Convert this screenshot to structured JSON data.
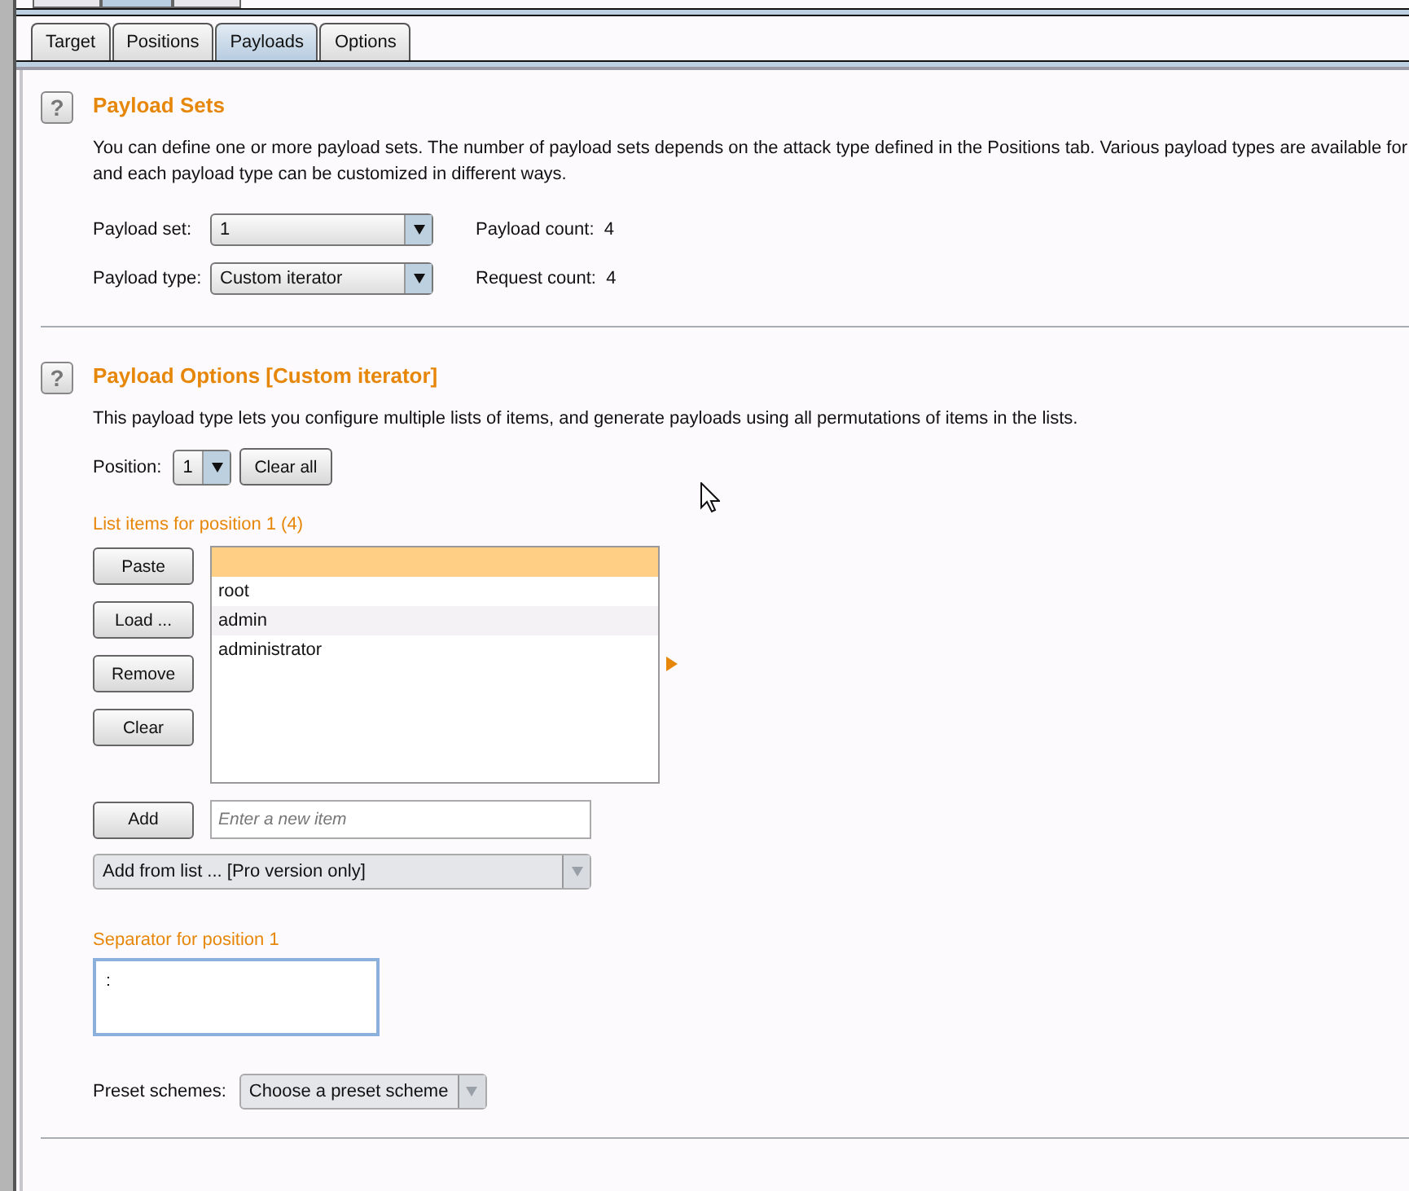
{
  "outer_tabs": [
    {
      "selected": false
    },
    {
      "selected": true
    },
    {
      "selected": false
    }
  ],
  "tabs": [
    {
      "label": "Target",
      "selected": false
    },
    {
      "label": "Positions",
      "selected": false
    },
    {
      "label": "Payloads",
      "selected": true
    },
    {
      "label": "Options",
      "selected": false
    }
  ],
  "payload_sets": {
    "help": "?",
    "title": "Payload Sets",
    "description": "You can define one or more payload sets. The number of payload sets depends on the attack type defined in the Positions tab. Various payload types are available for",
    "description_line_2": "and each payload type can be customized in different ways.",
    "fields": [
      {
        "label": "Payload set:",
        "value": "1",
        "count_label": "Payload count:",
        "count": "4"
      },
      {
        "label": "Payload type:",
        "value": "Custom iterator",
        "count_label": "Request count:",
        "count": "4"
      }
    ]
  },
  "payload_options": {
    "help": "?",
    "title": "Payload Options [Custom iterator]",
    "description": "This payload type lets you configure multiple lists of items, and generate payloads using all permutations of items in the lists.",
    "position_label": "Position:",
    "position_value": "1",
    "clear_all": "Clear all",
    "list_label": "List items for position 1 (4)",
    "list_buttons": [
      "Paste",
      "Load ...",
      "Remove",
      "Clear"
    ],
    "blank_row_selected": true,
    "items": [
      {
        "label": "root",
        "selected": false
      },
      {
        "label": "admin",
        "selected": false
      },
      {
        "label": "administrator",
        "selected": false
      }
    ],
    "add_button": "Add",
    "new_item": {
      "placeholder": "Enter a new item"
    },
    "add_from_list": {
      "value": "Add from list ... [Pro version only]",
      "disabled": true
    },
    "separator_label": "Separator for position 1",
    "separator": {
      "value": ":"
    },
    "preset_label": "Preset schemes:",
    "preset": {
      "value": "Choose a preset scheme",
      "disabled": true
    }
  }
}
